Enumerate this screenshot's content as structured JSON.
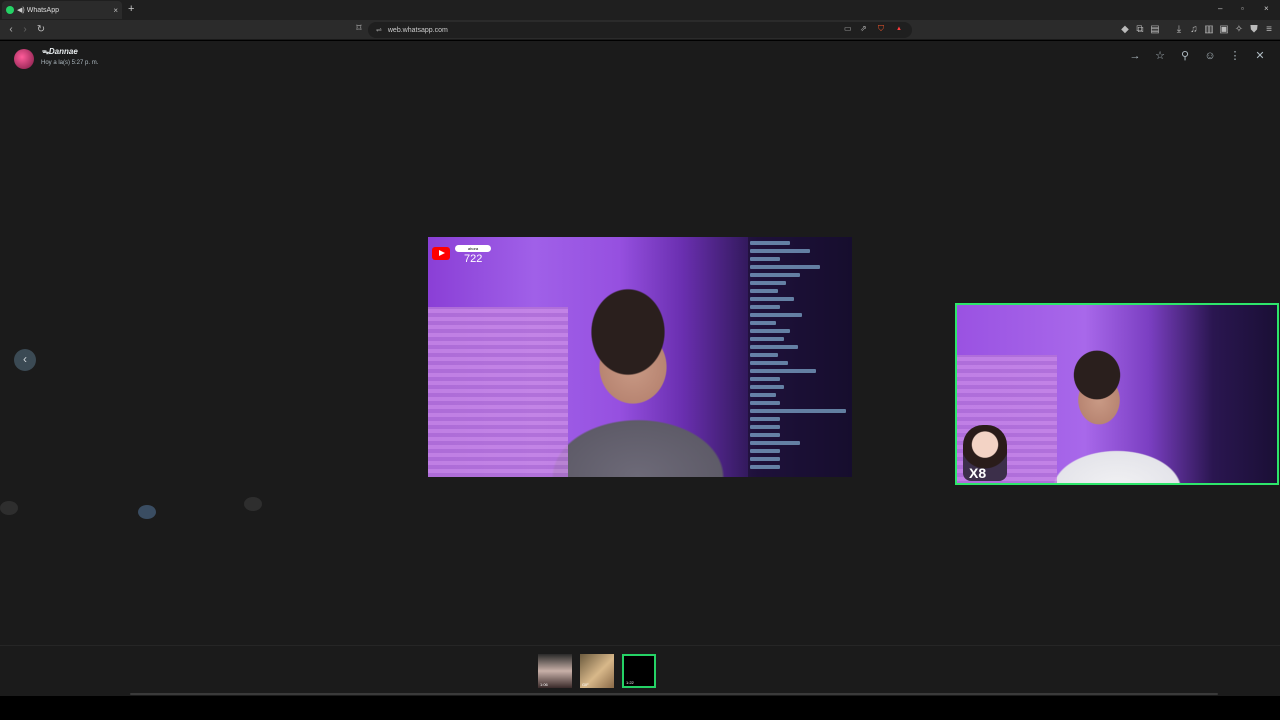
{
  "browser": {
    "tab_title": "WhatsApp",
    "tab_close": "×",
    "new_tab": "+",
    "url": "web.whatsapp.com",
    "window_controls": [
      "–",
      "▫",
      "×"
    ]
  },
  "viewer": {
    "sender_name": "ᯓDannae",
    "timestamp": "Hoy a la(s) 5:27 p. m.",
    "icons": [
      "forward-icon",
      "star-icon",
      "pin-icon",
      "emoji-icon",
      "menu-icon",
      "close-icon"
    ],
    "prev_arrow": "‹"
  },
  "main_video": {
    "viewer_count": "722",
    "pill_text": "ahora"
  },
  "pip": {
    "sticker_text": "X8"
  },
  "thumbnails": [
    {
      "duration": "1:06"
    },
    {
      "duration": "GIF"
    },
    {
      "duration": "1:22"
    }
  ],
  "colors": {
    "viewer_bg": "#1b1b1b",
    "accent_green": "#25d366",
    "pip_border": "#2ee66b"
  }
}
